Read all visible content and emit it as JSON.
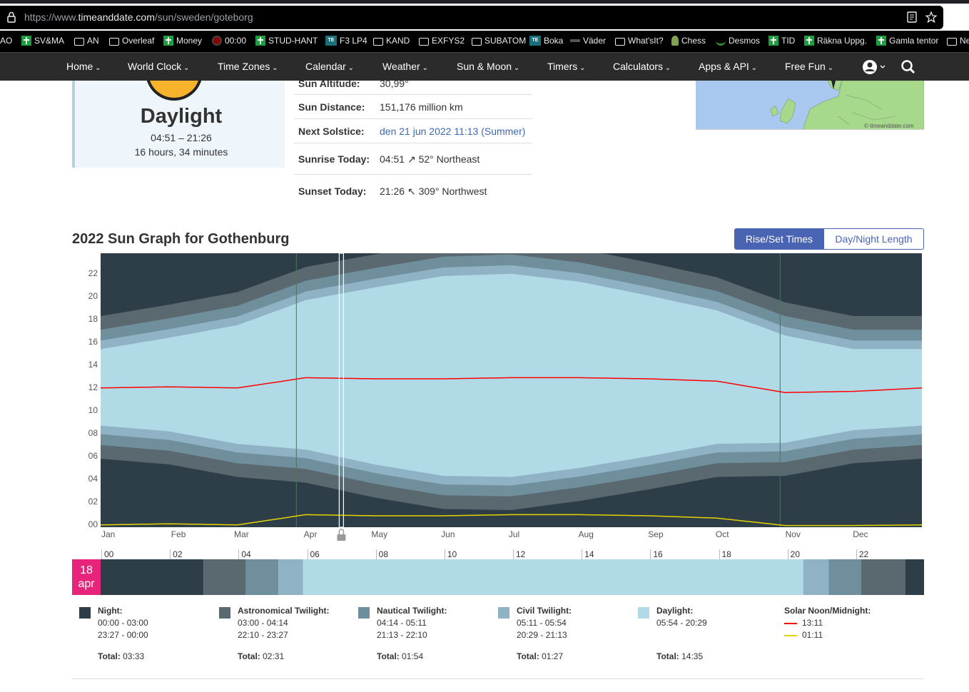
{
  "browser": {
    "url_prefix": "https://www.",
    "url_domain": "timeanddate.com",
    "url_path": "/sun/sweden/goteborg"
  },
  "bookmarks": [
    {
      "label": "AO",
      "icon": "none"
    },
    {
      "label": "SV&MA",
      "icon": "plus-icon"
    },
    {
      "label": "AN",
      "icon": "folder-icon"
    },
    {
      "label": "Overleaf",
      "icon": "folder-icon"
    },
    {
      "label": "Money",
      "icon": "plus-icon"
    },
    {
      "label": "00:00",
      "icon": "record-icon"
    },
    {
      "label": "STUD-HANT",
      "icon": "plus-icon"
    },
    {
      "label": "F3 LP4",
      "icon": "te-icon"
    },
    {
      "label": "KAND",
      "icon": "folder-icon"
    },
    {
      "label": "EXFYS2",
      "icon": "folder-icon"
    },
    {
      "label": "SUBATOM",
      "icon": "folder-icon"
    },
    {
      "label": "Boka",
      "icon": "te-icon"
    },
    {
      "label": "Väder",
      "icon": "smhi-icon"
    },
    {
      "label": "What'sIt?",
      "icon": "folder-icon"
    },
    {
      "label": "Chess",
      "icon": "pawn-icon"
    },
    {
      "label": "Desmos",
      "icon": "desmos-icon"
    },
    {
      "label": "TID",
      "icon": "plus-icon"
    },
    {
      "label": "Räkna Uppg.",
      "icon": "plus-icon"
    },
    {
      "label": "Gamla tentor",
      "icon": "plus-icon"
    },
    {
      "label": "Ne",
      "icon": "folder-icon"
    }
  ],
  "nav": {
    "items": [
      "Home",
      "World Clock",
      "Time Zones",
      "Calendar",
      "Weather",
      "Sun & Moon",
      "Timers",
      "Calculators",
      "Apps & API",
      "Free Fun"
    ]
  },
  "daycard": {
    "title": "Daylight",
    "times": "04:51 – 21:26",
    "length": "16 hours, 34 minutes"
  },
  "info": {
    "rows": [
      {
        "label": "Sun Altitude:",
        "value": "30,99°"
      },
      {
        "label": "Sun Distance:",
        "value": "151,176 million km"
      },
      {
        "label": "Next Solstice:",
        "value": "den 21 jun 2022 11:13 (Summer)"
      },
      {
        "label": "Sunrise Today:",
        "value": "04:51",
        "arrow": "↗",
        "extra": "52° Northeast"
      },
      {
        "label": "Sunset Today:",
        "value": "21:26",
        "arrow": "↖",
        "extra": "309° Northwest"
      }
    ]
  },
  "map": {
    "credit": "© timeanddate.com"
  },
  "sungraph": {
    "title": "2022 Sun Graph for Gothenburg",
    "toggle_active": "Rise/Set Times",
    "toggle_inactive": "Day/Night Length"
  },
  "colors": {
    "night": "#2d3e48",
    "astro": "#5a6870",
    "nautical": "#6f8f9c",
    "civil": "#8fb3c4",
    "daylight": "#b0dae6",
    "noon": "#ff0000",
    "midnight": "#e6d200",
    "dst": "#2e8b2e",
    "accent": "#4a64b4",
    "badge": "#e8237b"
  },
  "chart_data": {
    "type": "area",
    "title": "2022 Sun Graph for Gothenburg",
    "x_labels": [
      "Jan",
      "Feb",
      "Mar",
      "Apr",
      "May",
      "Jun",
      "Jul",
      "Aug",
      "Sep",
      "Oct",
      "Nov",
      "Dec"
    ],
    "y_ticks": [
      "00",
      "02",
      "04",
      "06",
      "08",
      "10",
      "12",
      "14",
      "16",
      "18",
      "20",
      "22"
    ],
    "ylim": [
      0,
      24
    ],
    "dst_period_days": [
      87,
      302
    ],
    "current_day": 107,
    "series": [
      {
        "name": "Daylight",
        "sunrise_hours": [
          8.9,
          8.4,
          7.3,
          6.8,
          5.5,
          4.5,
          4.4,
          5.2,
          6.2,
          7.3,
          7.4,
          8.5,
          8.9
        ],
        "sunset_hours": [
          15.6,
          16.6,
          17.7,
          19.9,
          21.0,
          22.0,
          22.2,
          21.5,
          20.3,
          19.0,
          16.8,
          15.6,
          15.6
        ]
      },
      {
        "name": "Solar Noon",
        "hours": [
          12.2,
          12.3,
          12.2,
          13.1,
          13.0,
          13.0,
          13.1,
          13.1,
          13.0,
          12.8,
          11.8,
          11.9,
          12.2
        ]
      },
      {
        "name": "Solar Midnight",
        "hours": [
          0.2,
          0.3,
          0.2,
          1.1,
          1.0,
          1.0,
          1.1,
          1.1,
          1.0,
          0.8,
          23.8,
          23.9,
          0.2
        ]
      }
    ]
  },
  "daybar": {
    "day": "18",
    "month": "apr",
    "hours": [
      "00",
      "02",
      "04",
      "06",
      "08",
      "10",
      "12",
      "14",
      "16",
      "18",
      "20",
      "22"
    ],
    "segments": [
      {
        "phase": "night",
        "from": 0.0,
        "to": 3.0
      },
      {
        "phase": "astro",
        "from": 3.0,
        "to": 4.23
      },
      {
        "phase": "nautical",
        "from": 4.23,
        "to": 5.18
      },
      {
        "phase": "civil",
        "from": 5.18,
        "to": 5.9
      },
      {
        "phase": "daylight",
        "from": 5.9,
        "to": 20.48
      },
      {
        "phase": "civil",
        "from": 20.48,
        "to": 21.22
      },
      {
        "phase": "nautical",
        "from": 21.22,
        "to": 22.17
      },
      {
        "phase": "astro",
        "from": 22.17,
        "to": 23.45
      },
      {
        "phase": "night",
        "from": 23.45,
        "to": 24.0
      }
    ]
  },
  "legend": [
    {
      "key": "night",
      "title": "Night:",
      "l1": "00:00 - 03:00",
      "l2": "23:27 - 00:00",
      "total_label": "Total:",
      "total": "03:33"
    },
    {
      "key": "astro",
      "title": "Astronomical Twilight:",
      "l1": "03:00 - 04:14",
      "l2": "22:10 - 23:27",
      "total_label": "Total:",
      "total": "02:31"
    },
    {
      "key": "nautical",
      "title": "Nautical Twilight:",
      "l1": "04:14 - 05:11",
      "l2": "21:13 - 22:10",
      "total_label": "Total:",
      "total": "01:54"
    },
    {
      "key": "civil",
      "title": "Civil Twilight:",
      "l1": "05:11 - 05:54",
      "l2": "20:29 - 21:13",
      "total_label": "Total:",
      "total": "01:27"
    },
    {
      "key": "daylight",
      "title": "Daylight:",
      "l1": "05:54 - 20:29",
      "l2": "",
      "total_label": "Total:",
      "total": "14:35"
    }
  ],
  "solar_legend": {
    "title": "Solar Noon/Midnight:",
    "noon": "13:11",
    "midnight": "01:11"
  }
}
